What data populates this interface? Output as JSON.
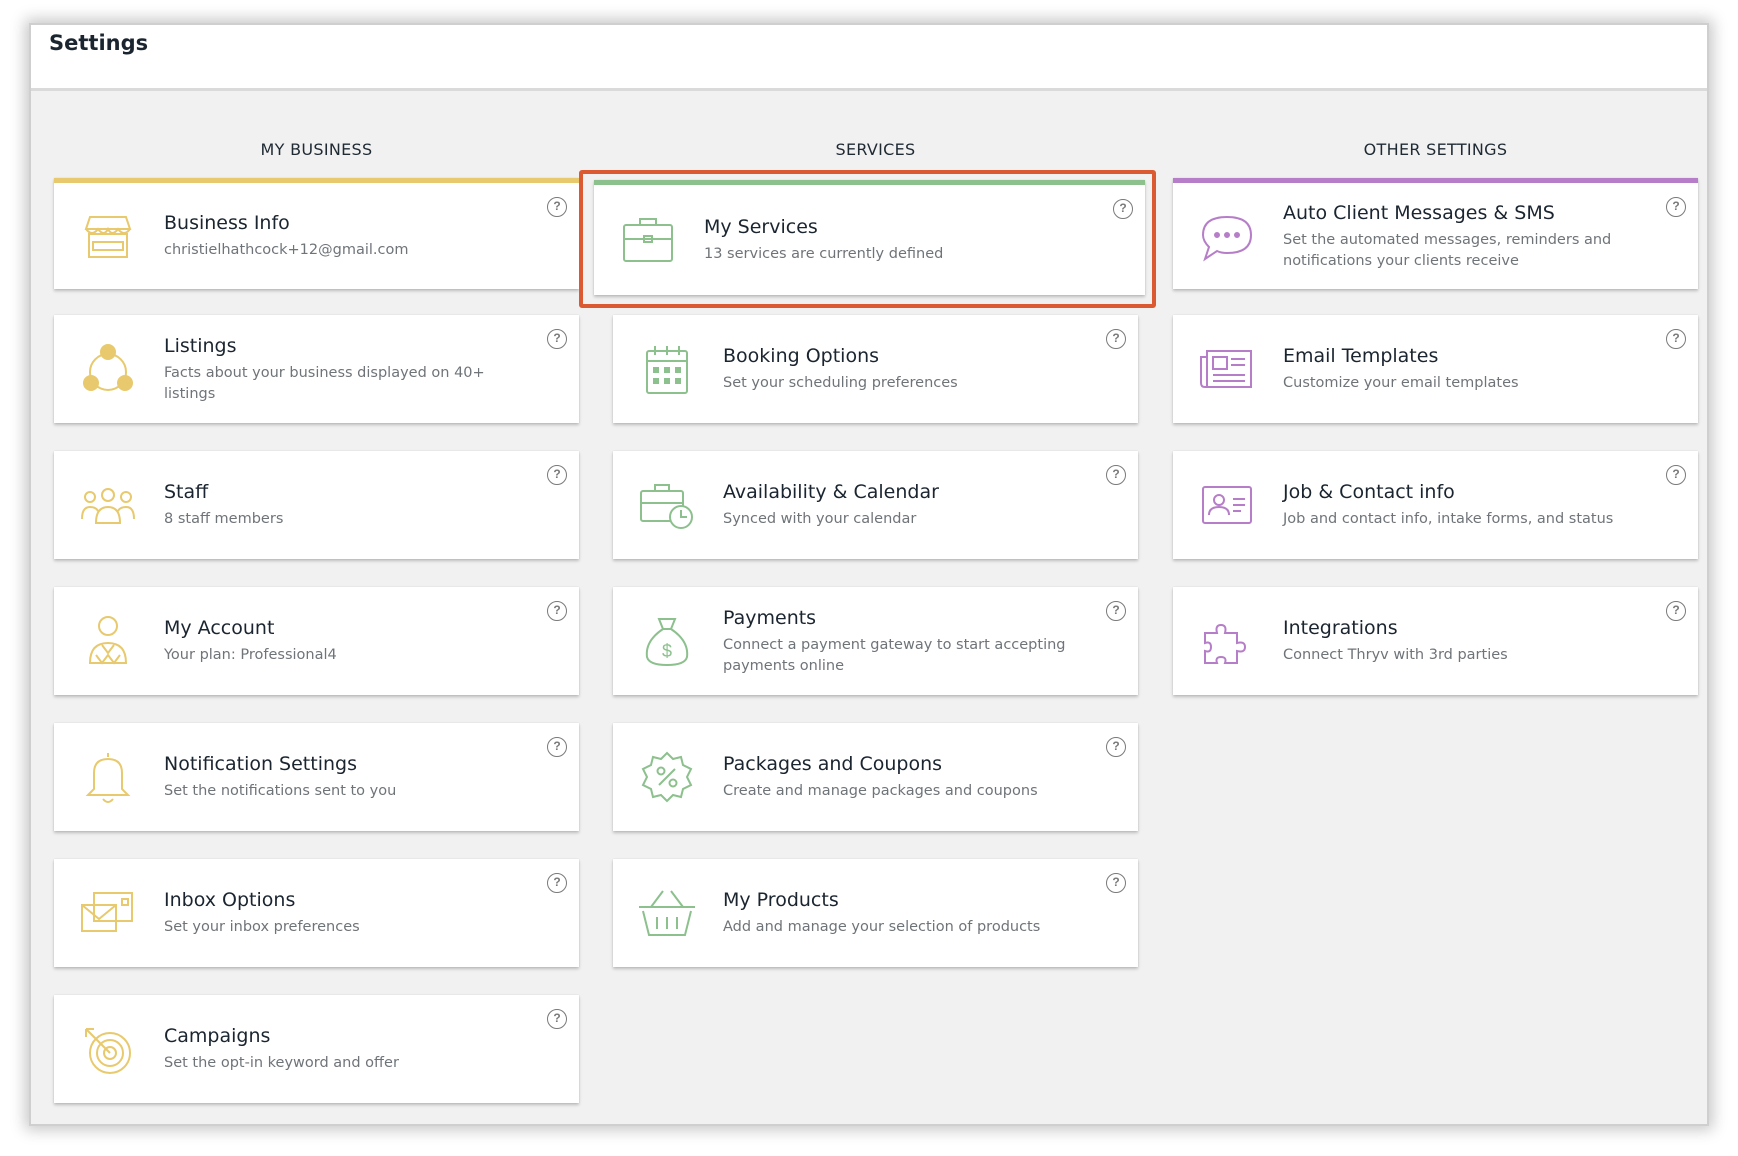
{
  "page": {
    "title": "Settings"
  },
  "columns": {
    "my_business": "MY BUSINESS",
    "services": "SERVICES",
    "other_settings": "OTHER SETTINGS"
  },
  "help_glyph": "?",
  "colors": {
    "my_business_accent": "#e8c96d",
    "services_accent": "#8cc08d",
    "other_settings_accent": "#b67ec8",
    "highlight": "#dc5a31"
  },
  "my_business": [
    {
      "name": "Business Info",
      "desc": "christielhathcock+12@gmail.com",
      "icon": "storefront-icon"
    },
    {
      "name": "Listings",
      "desc": "Facts about your business displayed on 40+ listings",
      "icon": "network-icon"
    },
    {
      "name": "Staff",
      "desc": "8 staff members",
      "icon": "people-group-icon"
    },
    {
      "name": "My Account",
      "desc": "Your plan: Professional4",
      "icon": "user-account-icon"
    },
    {
      "name": "Notification Settings",
      "desc": "Set the notifications sent to you",
      "icon": "bell-icon"
    },
    {
      "name": "Inbox Options",
      "desc": "Set your inbox preferences",
      "icon": "inbox-envelope-icon"
    },
    {
      "name": "Campaigns",
      "desc": "Set the opt-in keyword and offer",
      "icon": "target-icon"
    }
  ],
  "services": [
    {
      "name": "My Services",
      "desc": "13 services are currently defined",
      "icon": "briefcase-icon",
      "highlighted": true
    },
    {
      "name": "Booking Options",
      "desc": "Set your scheduling preferences",
      "icon": "calendar-icon"
    },
    {
      "name": "Availability & Calendar",
      "desc": "Synced with your calendar",
      "icon": "briefcase-clock-icon"
    },
    {
      "name": "Payments",
      "desc": "Connect a payment gateway to start accepting payments online",
      "icon": "money-bag-icon"
    },
    {
      "name": "Packages and Coupons",
      "desc": "Create and manage packages and coupons",
      "icon": "coupon-badge-icon"
    },
    {
      "name": "My Products",
      "desc": "Add and manage your selection of products",
      "icon": "basket-icon"
    }
  ],
  "other_settings": [
    {
      "name": "Auto Client Messages & SMS",
      "desc": "Set the automated messages, reminders and notifications your clients receive",
      "icon": "chat-bubble-icon"
    },
    {
      "name": "Email Templates",
      "desc": "Customize your email templates",
      "icon": "newspaper-icon"
    },
    {
      "name": "Job & Contact info",
      "desc": "Job and contact info, intake forms, and status",
      "icon": "contact-card-icon"
    },
    {
      "name": "Integrations",
      "desc": "Connect Thryv with 3rd parties",
      "icon": "puzzle-icon"
    }
  ]
}
